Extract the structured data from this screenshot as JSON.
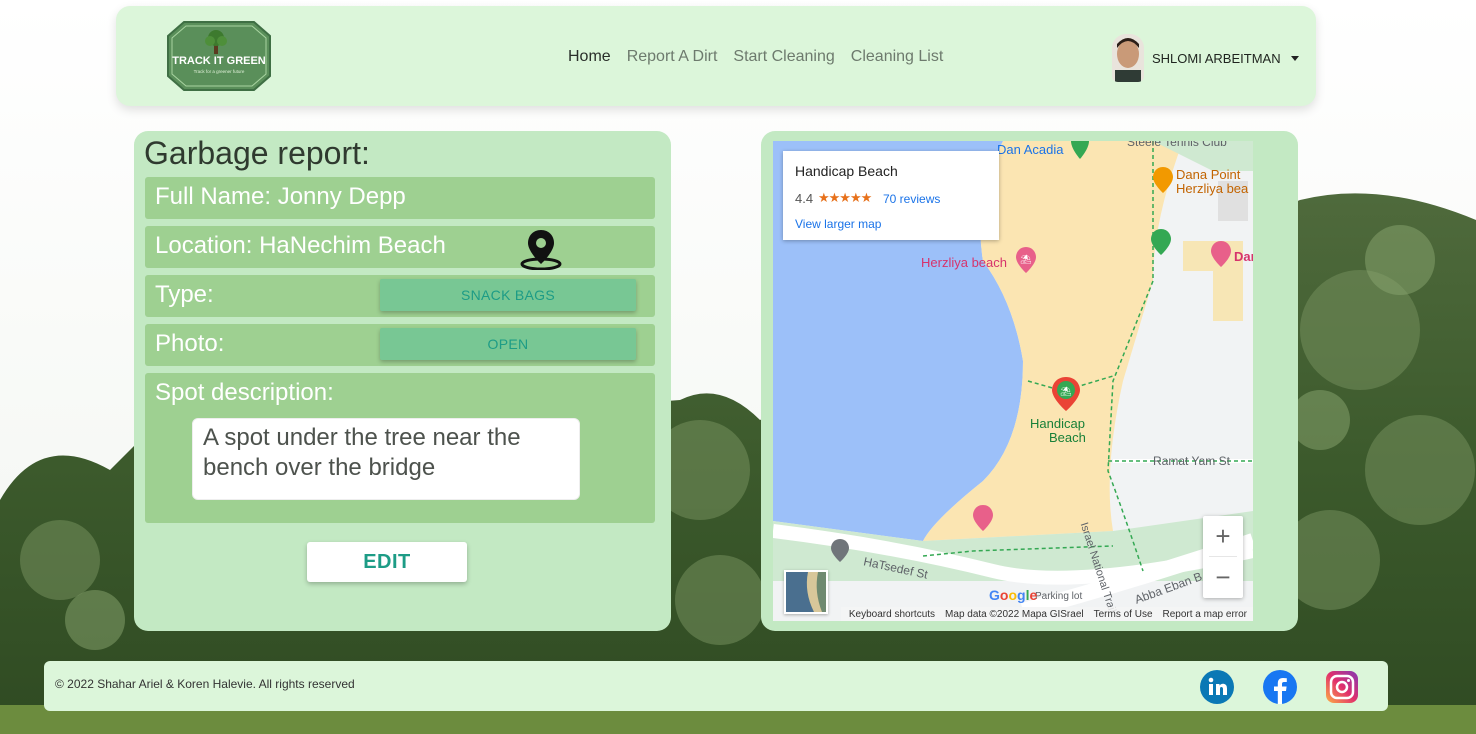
{
  "brand": {
    "logo_text": "TRACK IT GREEN",
    "logo_tagline": "Track for a greener future"
  },
  "nav": {
    "links": [
      "Home",
      "Report A Dirt",
      "Start Cleaning",
      "Cleaning List"
    ],
    "active": "Home",
    "user_name": "SHLOMI ARBEITMAN"
  },
  "report": {
    "title": "Garbage report:",
    "full_name": "Full Name: Jonny Depp",
    "location": "Location: HaNechim Beach",
    "type_label": "Type:",
    "type_value": "SNACK BAGS",
    "photo_label": "Photo:",
    "photo_button": "OPEN",
    "description_label": "Spot description:",
    "description": "A spot under the tree near the bench over the bridge",
    "edit_button": "EDIT"
  },
  "map": {
    "place_title": "Handicap Beach",
    "rating": "4.4",
    "stars": "★★★★★",
    "reviews": "70 reviews",
    "larger_map": "View larger map",
    "labels": {
      "dan_acadia": "Dan Acadia",
      "tennis": "Steele Tennis Club",
      "dana_point": "Dana Point",
      "dana_point_2": "Herzliya bea",
      "herzliya": "Herzliya beach",
      "dan": "Dan",
      "handicap_1": "Handicap",
      "handicap_2": "Beach",
      "ramat_yam": "Ramat Yam St",
      "trail": "Israel National Trail",
      "hatsedef": "HaTsedef St",
      "abba_eban": "Abba Eban B",
      "parking": "Parking lot"
    },
    "google": "Google",
    "zoom_in": "+",
    "zoom_out": "−",
    "footer": {
      "shortcuts": "Keyboard shortcuts",
      "map_data": "Map data ©2022 Mapa GISrael",
      "terms": "Terms of Use",
      "report": "Report a map error"
    }
  },
  "footer": {
    "copyright": "© 2022 Shahar Ariel & Koren Halevie. All rights reserved"
  },
  "colors": {
    "accent": "#1d9c86",
    "card": "#c3e9c3",
    "row": "#9ed091",
    "nav_bg": "#dcf6da"
  }
}
